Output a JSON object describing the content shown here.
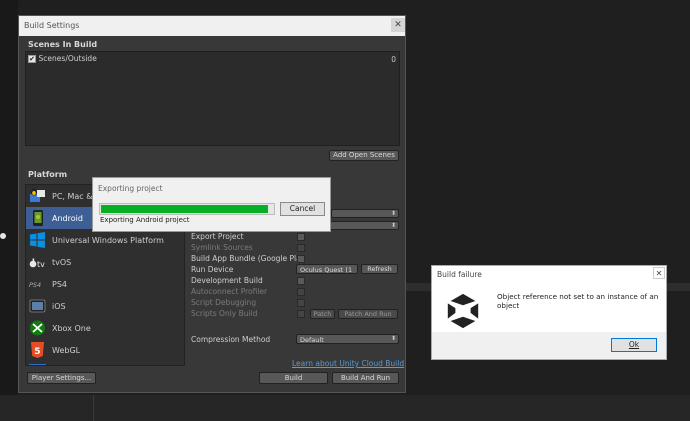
{
  "window": {
    "title": "Build Settings",
    "close_glyph": "✕"
  },
  "scenes": {
    "header": "Scenes In Build",
    "items": [
      {
        "name": "Scenes/Outside",
        "index": "0",
        "checked": true
      }
    ],
    "add_open_scenes": "Add Open Scenes"
  },
  "platform": {
    "header": "Platform",
    "items": [
      {
        "label": "PC, Mac & ",
        "icon": "pc-mac-linux-icon"
      },
      {
        "label": "Android",
        "icon": "android-icon",
        "selected": true
      },
      {
        "label": "Universal Windows Platform",
        "icon": "windows-icon"
      },
      {
        "label": "tvOS",
        "icon": "appletv-icon",
        "icon_text": "tv"
      },
      {
        "label": "PS4",
        "icon": "ps4-icon",
        "icon_text": "PS4"
      },
      {
        "label": "iOS",
        "icon": "ios-icon"
      },
      {
        "label": "Xbox One",
        "icon": "xbox-icon"
      },
      {
        "label": "WebGL",
        "icon": "html5-icon",
        "icon_text": "5"
      }
    ]
  },
  "options": {
    "export_project": "Export Project",
    "symlink_sources": "Symlink Sources",
    "build_app_bundle": "Build App Bundle (Google Play",
    "run_device": "Run Device",
    "run_device_value": "Oculus Quest (1",
    "refresh": "Refresh",
    "development_build": "Development Build",
    "autoconnect_profiler": "Autoconnect Profiler",
    "script_debugging": "Script Debugging",
    "scripts_only_build": "Scripts Only Build",
    "patch": "Patch",
    "patch_and_run": "Patch And Run",
    "compression_method": "Compression Method",
    "compression_value": "Default",
    "cloud_build_link": "Learn about Unity Cloud Build"
  },
  "buttons": {
    "player_settings": "Player Settings...",
    "build": "Build",
    "build_and_run": "Build And Run"
  },
  "progress": {
    "title": "Exporting project",
    "message": "Exporting Android project",
    "cancel": "Cancel",
    "fraction": 0.97,
    "color": "#06b025"
  },
  "failure": {
    "title": "Build failure",
    "message": "Object reference not set to an instance of an object",
    "ok": "Ok",
    "close_glyph": "✕"
  }
}
